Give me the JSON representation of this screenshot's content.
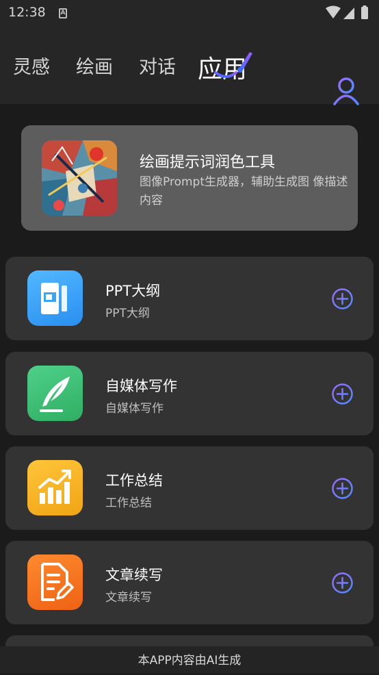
{
  "status_bar": {
    "time": "12:38"
  },
  "header": {
    "tabs": [
      {
        "label": "灵感"
      },
      {
        "label": "绘画"
      },
      {
        "label": "对话"
      },
      {
        "label": "应用"
      }
    ],
    "active_tab": "应用"
  },
  "feature": {
    "title": "绘画提示词润色工具",
    "description": "图像Prompt生成器，辅助生成图 像描述内容"
  },
  "apps": [
    {
      "title": "PPT大纲",
      "subtitle": "PPT大纲",
      "icon": "ppt-icon",
      "color": "#3aa5f3"
    },
    {
      "title": "自媒体写作",
      "subtitle": "自媒体写作",
      "icon": "feather-icon",
      "color": "#3dbd74"
    },
    {
      "title": "工作总结",
      "subtitle": "工作总结",
      "icon": "chart-icon",
      "color": "#f5b11c"
    },
    {
      "title": "文章续写",
      "subtitle": "文章续写",
      "icon": "document-edit-icon",
      "color": "#f27020"
    }
  ],
  "footer": {
    "text": "本APP内容由AI生成"
  },
  "colors": {
    "accent_gradient_start": "#7b5cff",
    "accent_gradient_end": "#4aa8ff"
  }
}
